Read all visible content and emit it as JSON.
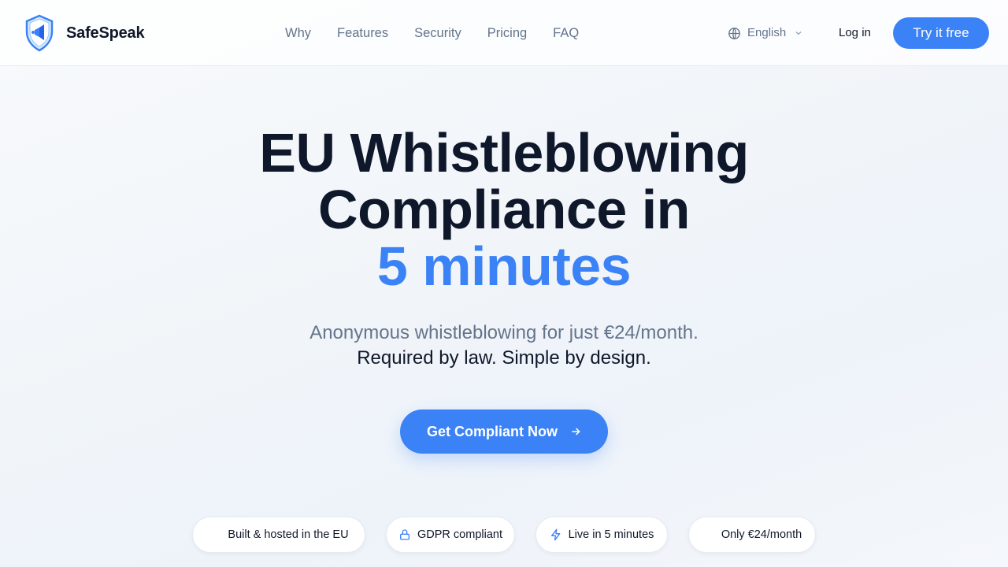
{
  "header": {
    "brand": "SafeSpeak",
    "nav": [
      "Why",
      "Features",
      "Security",
      "Pricing",
      "FAQ"
    ],
    "language": "English",
    "login": "Log in",
    "try_free": "Try it free"
  },
  "hero": {
    "title_line1": "EU Whistleblowing",
    "title_line2": "Compliance in",
    "title_accent": "5 minutes",
    "subtitle": "Anonymous whistleblowing for just €24/month.",
    "tagline": "Required by law. Simple by design.",
    "cta": "Get Compliant Now"
  },
  "badges": [
    {
      "label": "Built & hosted in the EU",
      "icon": "eu-flag-icon"
    },
    {
      "label": "GDPR compliant",
      "icon": "lock-icon"
    },
    {
      "label": "Live in 5 minutes",
      "icon": "lightning-icon"
    },
    {
      "label": "Only €24/month",
      "icon": "euro-icon"
    }
  ],
  "colors": {
    "accent": "#3b82f6",
    "heading": "#0f172a",
    "muted": "#64748b"
  }
}
